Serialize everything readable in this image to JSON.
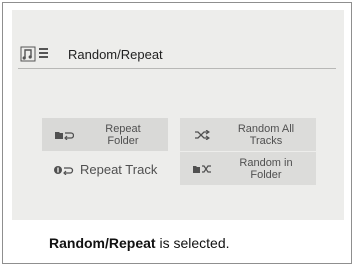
{
  "screen": {
    "title": "Random/Repeat",
    "title_icons": [
      "music-note-icon",
      "list-icon"
    ]
  },
  "options": {
    "repeat_folder": {
      "line1": "Repeat",
      "line2": "Folder",
      "icon": "repeat-folder-icon",
      "highlighted": true
    },
    "random_all_tracks": {
      "line1": "Random All",
      "line2": "Tracks",
      "icon": "shuffle-icon"
    },
    "repeat_track": {
      "label": "Repeat Track",
      "icon": "repeat-one-icon"
    },
    "random_in_folder": {
      "line1": "Random in",
      "line2": "Folder",
      "icon": "shuffle-folder-icon"
    }
  },
  "caption": {
    "bold": "Random/Repeat",
    "rest": " is selected."
  }
}
